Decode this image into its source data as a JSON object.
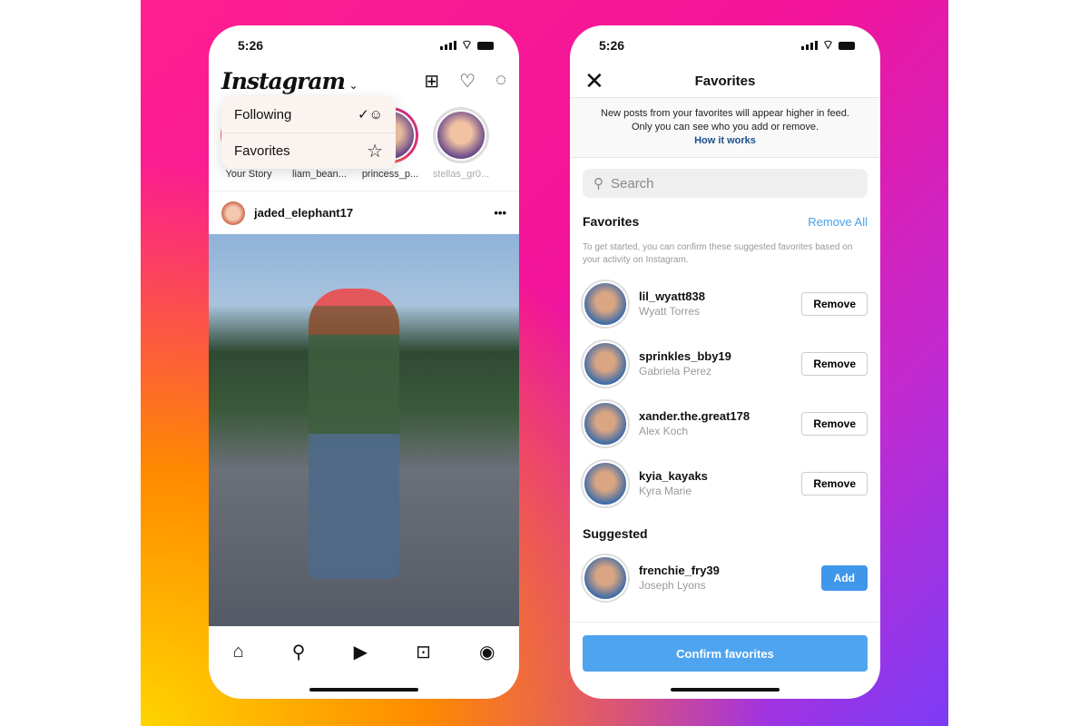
{
  "colors": {
    "accent": "#3f97ea",
    "link": "#1b4f8a"
  },
  "feed": {
    "time": "5:26",
    "logo": "Instagram",
    "header_icons": [
      "plus-square-icon",
      "heart-icon",
      "messenger-icon"
    ],
    "menu": [
      {
        "label": "Following",
        "icon": "following-icon"
      },
      {
        "label": "Favorites",
        "icon": "star-icon"
      }
    ],
    "stories": [
      "Your Story",
      "liam_bean...",
      "princess_p...",
      "stellas_gr0..."
    ],
    "post_user": "jaded_elephant17",
    "nav": [
      "home-icon",
      "search-icon",
      "reels-icon",
      "shop-icon",
      "profile-icon"
    ]
  },
  "favorites": {
    "time": "5:26",
    "title": "Favorites",
    "info_line1": "New posts from your favorites will appear higher in feed.",
    "info_line2": "Only you can see who you add or remove.",
    "how_it_works": "How it works",
    "search_placeholder": "Search",
    "section_favorites": "Favorites",
    "remove_all": "Remove All",
    "hint": "To get started, you can confirm these suggested favorites based on your activity on Instagram.",
    "items": [
      {
        "username": "lil_wyatt838",
        "name": "Wyatt Torres",
        "action": "Remove"
      },
      {
        "username": "sprinkles_bby19",
        "name": "Gabriela Perez",
        "action": "Remove"
      },
      {
        "username": "xander.the.great178",
        "name": "Alex Koch",
        "action": "Remove"
      },
      {
        "username": "kyia_kayaks",
        "name": "Kyra Marie",
        "action": "Remove"
      }
    ],
    "section_suggested": "Suggested",
    "suggested": [
      {
        "username": "frenchie_fry39",
        "name": "Joseph Lyons",
        "action": "Add"
      }
    ],
    "confirm": "Confirm favorites"
  }
}
